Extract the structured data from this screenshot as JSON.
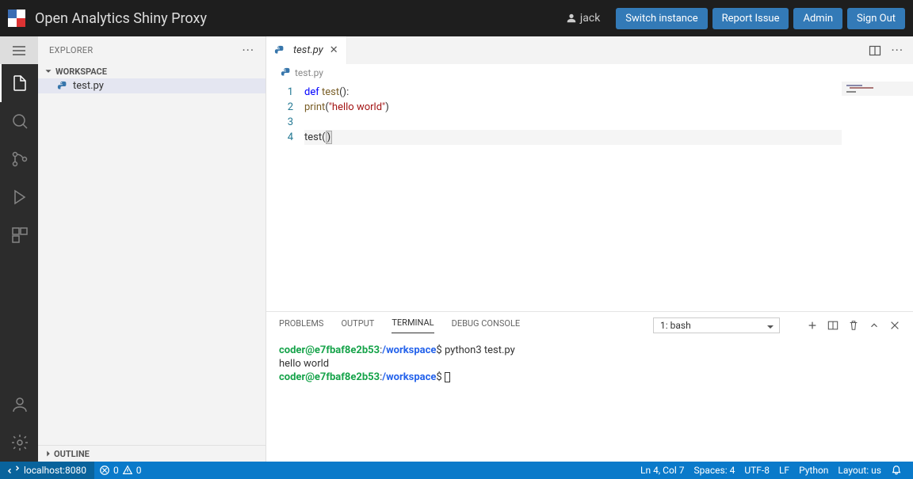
{
  "header": {
    "title": "Open Analytics Shiny Proxy",
    "user": "jack",
    "buttons": {
      "switch": "Switch instance",
      "report": "Report Issue",
      "admin": "Admin",
      "signout": "Sign Out"
    }
  },
  "sidebar": {
    "title": "EXPLORER",
    "workspace_label": "WORKSPACE",
    "files": [
      "test.py"
    ],
    "outline_label": "OUTLINE"
  },
  "editor": {
    "tab_name": "test.py",
    "breadcrumb": "test.py",
    "line_numbers": [
      "1",
      "2",
      "3",
      "4"
    ],
    "code": {
      "l1": {
        "kw": "def",
        "fn": "test",
        "pn": "():"
      },
      "l2": {
        "indent": "    ",
        "fn": "print",
        "open": "(",
        "str": "\"hello world\"",
        "close": ")"
      },
      "l3": "",
      "l4": {
        "fn": "test",
        "open": "(",
        "close": ")"
      }
    }
  },
  "panel": {
    "tabs": {
      "problems": "PROBLEMS",
      "output": "OUTPUT",
      "terminal": "TERMINAL",
      "debug": "DEBUG CONSOLE"
    },
    "terminal_select": "1: bash",
    "terminal_lines": {
      "prompt_user": "coder@e7fbaf8e2b53",
      "colon": ":",
      "path": "/workspace",
      "dollar": "$",
      "cmd1": "python3 test.py",
      "out1": "hello world"
    }
  },
  "status": {
    "remote": "localhost:8080",
    "errors": "0",
    "warnings": "0",
    "ln": "Ln 4, Col 7",
    "spaces": "Spaces: 4",
    "encoding": "UTF-8",
    "eol": "LF",
    "lang": "Python",
    "layout": "Layout: us"
  }
}
